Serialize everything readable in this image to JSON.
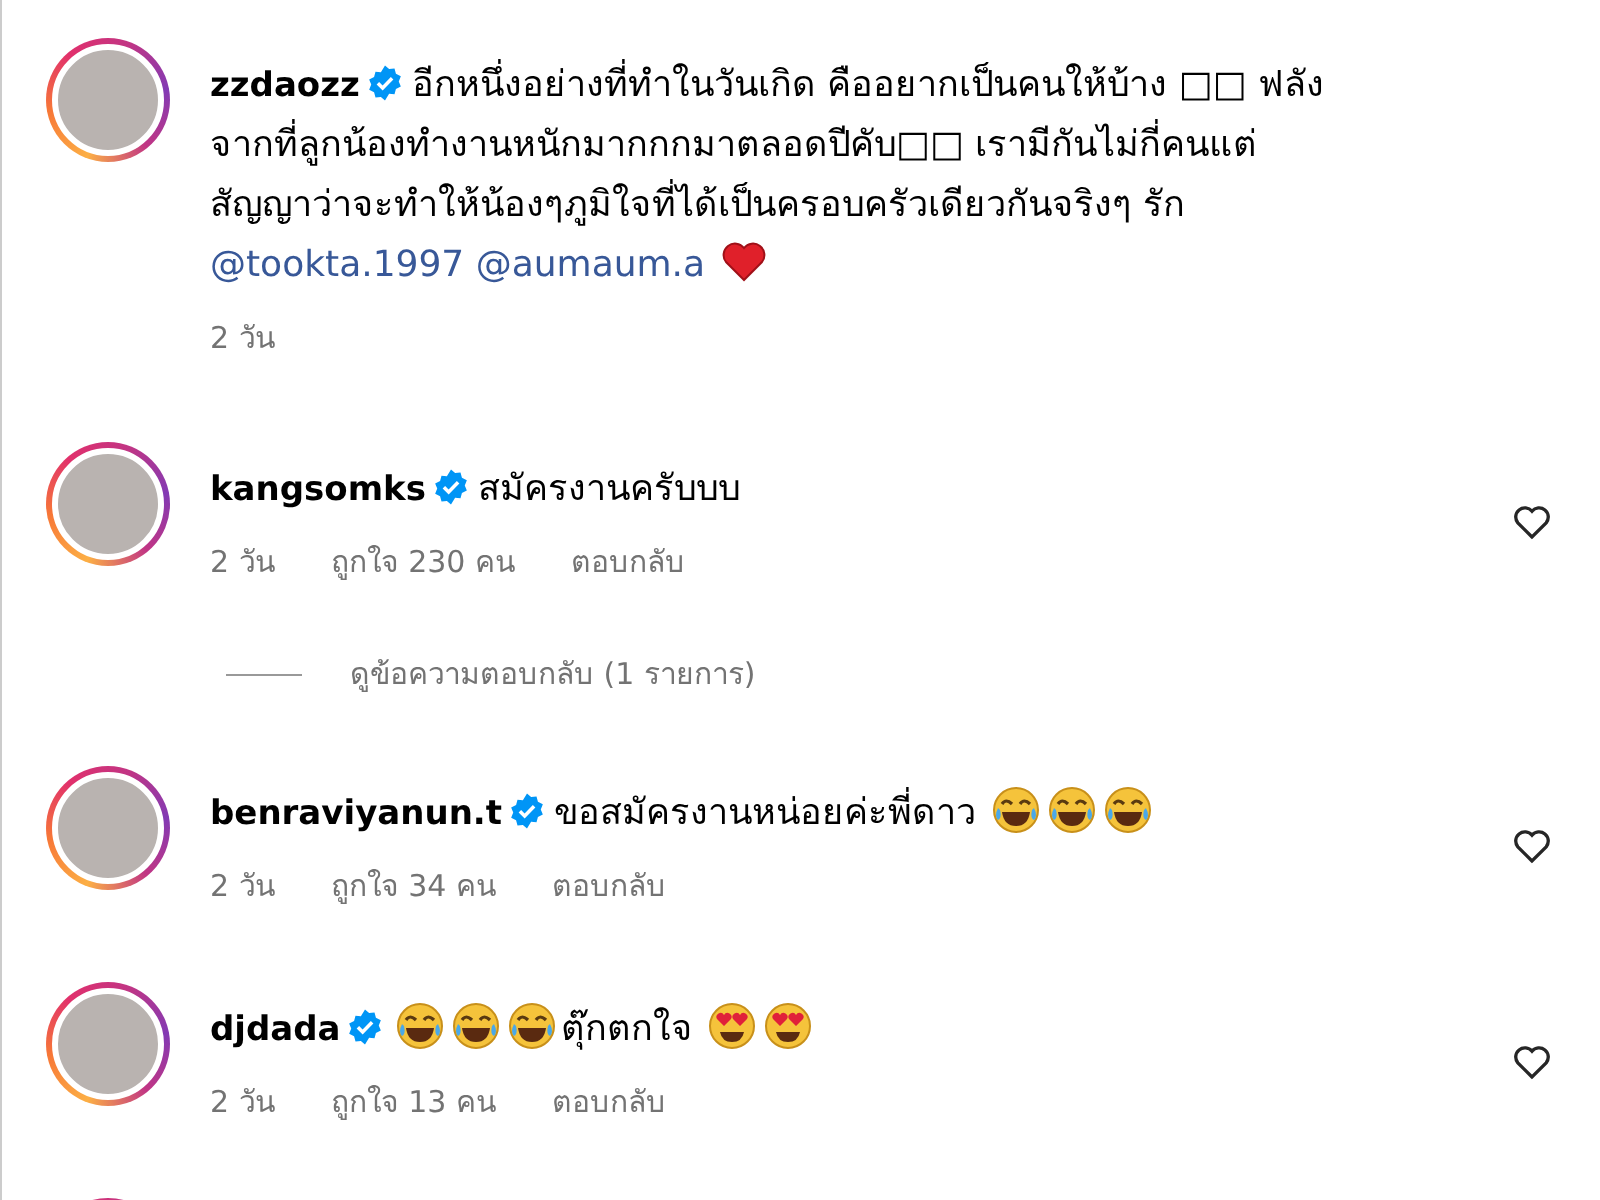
{
  "comments": [
    {
      "kind": "caption",
      "username": "zzdaozz",
      "verified": true,
      "parts": [
        {
          "kind": "text",
          "text": "อีกหนึ่งอย่างที่ทำในวันเกิด คืออยากเป็นคนให้บ้าง □□ ฟลังจากที่ลูกน้องทำงานหนักมากกกมาตลอดปีคับ□□ เรามีกันไม่กี่คนแต่สัญญาว่าจะทำให้น้องๆภูมิใจที่ได้เป็นครอบครัวเดียวกันจริงๆ รัก"
        },
        {
          "kind": "mention",
          "text": "@tookta.1997"
        },
        {
          "kind": "mention",
          "text": "@aumaum.a"
        },
        {
          "kind": "heart"
        }
      ],
      "time": "2 วัน"
    },
    {
      "kind": "comment",
      "username": "kangsomks",
      "verified": true,
      "parts": [
        {
          "kind": "text",
          "text": "สมัครงานครับบบ"
        }
      ],
      "time": "2 วัน",
      "likes": "ถูกใจ 230 คน",
      "reply": "ตอบกลับ",
      "liked": false,
      "view_replies": "ดูข้อความตอบกลับ (1 รายการ)"
    },
    {
      "kind": "comment",
      "username": "benraviyanun.t",
      "verified": true,
      "parts": [
        {
          "kind": "text",
          "text": "ขอสมัครงานหน่อยค่ะพี่ดาว"
        },
        {
          "kind": "laugh"
        },
        {
          "kind": "laugh"
        },
        {
          "kind": "laugh"
        }
      ],
      "time": "2 วัน",
      "likes": "ถูกใจ 34 คน",
      "reply": "ตอบกลับ",
      "liked": false
    },
    {
      "kind": "comment",
      "username": "djdada",
      "verified": true,
      "parts": [
        {
          "kind": "laugh"
        },
        {
          "kind": "laugh"
        },
        {
          "kind": "laugh"
        },
        {
          "kind": "text",
          "text": "ตุ๊กตกใจ"
        },
        {
          "kind": "hearteyes"
        },
        {
          "kind": "hearteyes"
        }
      ],
      "time": "2 วัน",
      "likes": "ถูกใจ 13 คน",
      "reply": "ตอบกลับ",
      "liked": false
    },
    {
      "kind": "cut"
    }
  ]
}
